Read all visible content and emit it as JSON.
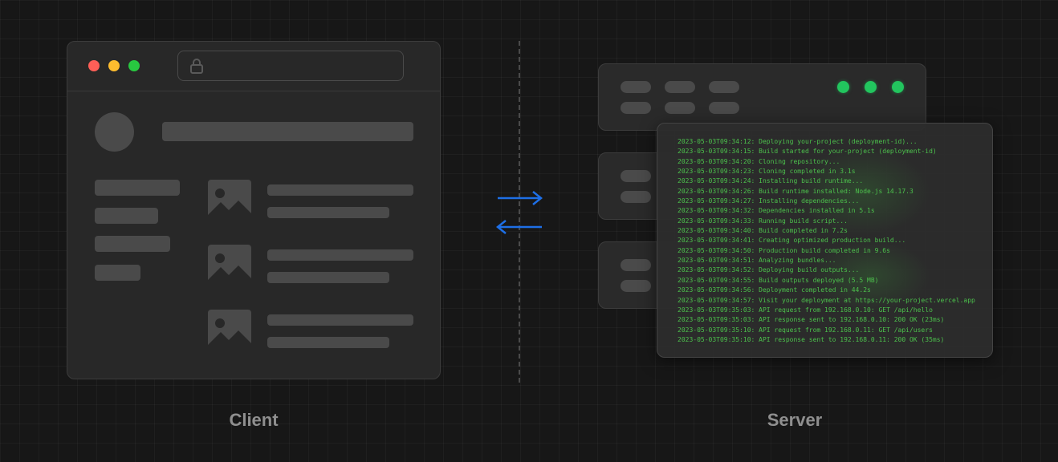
{
  "labels": {
    "client": "Client",
    "server": "Server"
  },
  "icons": {
    "lock": "lock-icon",
    "image": "image-icon",
    "arrow_right": "arrow-right-icon",
    "arrow_left": "arrow-left-icon"
  },
  "colors": {
    "background": "#171717",
    "window_red": "#ff5f57",
    "window_yellow": "#febc2e",
    "window_green": "#28c840",
    "status_green": "#22c55e",
    "arrow_blue": "#1e6fe6",
    "log_text": "#4cc04c"
  },
  "server_logs": [
    "2023-05-03T09:34:12: Deploying your-project (deployment-id)...",
    "2023-05-03T09:34:15: Build started for your-project (deployment-id)",
    "2023-05-03T09:34:20: Cloning repository...",
    "2023-05-03T09:34:23: Cloning completed in 3.1s",
    "2023-05-03T09:34:24: Installing build runtime...",
    "2023-05-03T09:34:26: Build runtime installed: Node.js 14.17.3",
    "2023-05-03T09:34:27: Installing dependencies...",
    "2023-05-03T09:34:32: Dependencies installed in 5.1s",
    "2023-05-03T09:34:33: Running build script...",
    "2023-05-03T09:34:40: Build completed in 7.2s",
    "2023-05-03T09:34:41: Creating optimized production build...",
    "2023-05-03T09:34:50: Production build completed in 9.6s",
    "2023-05-03T09:34:51: Analyzing bundles...",
    "2023-05-03T09:34:52: Deploying build outputs...",
    "2023-05-03T09:34:55: Build outputs deployed (5.5 MB)",
    "2023-05-03T09:34:56: Deployment completed in 44.2s",
    "2023-05-03T09:34:57: Visit your deployment at https://your-project.vercel.app",
    "2023-05-03T09:35:03: API request from 192.168.0.10: GET /api/hello",
    "2023-05-03T09:35:03: API response sent to 192.168.0.10: 200 OK (23ms)",
    "2023-05-03T09:35:10: API request from 192.168.0.11: GET /api/users",
    "2023-05-03T09:35:10: API response sent to 192.168.0.11: 200 OK (35ms)"
  ]
}
